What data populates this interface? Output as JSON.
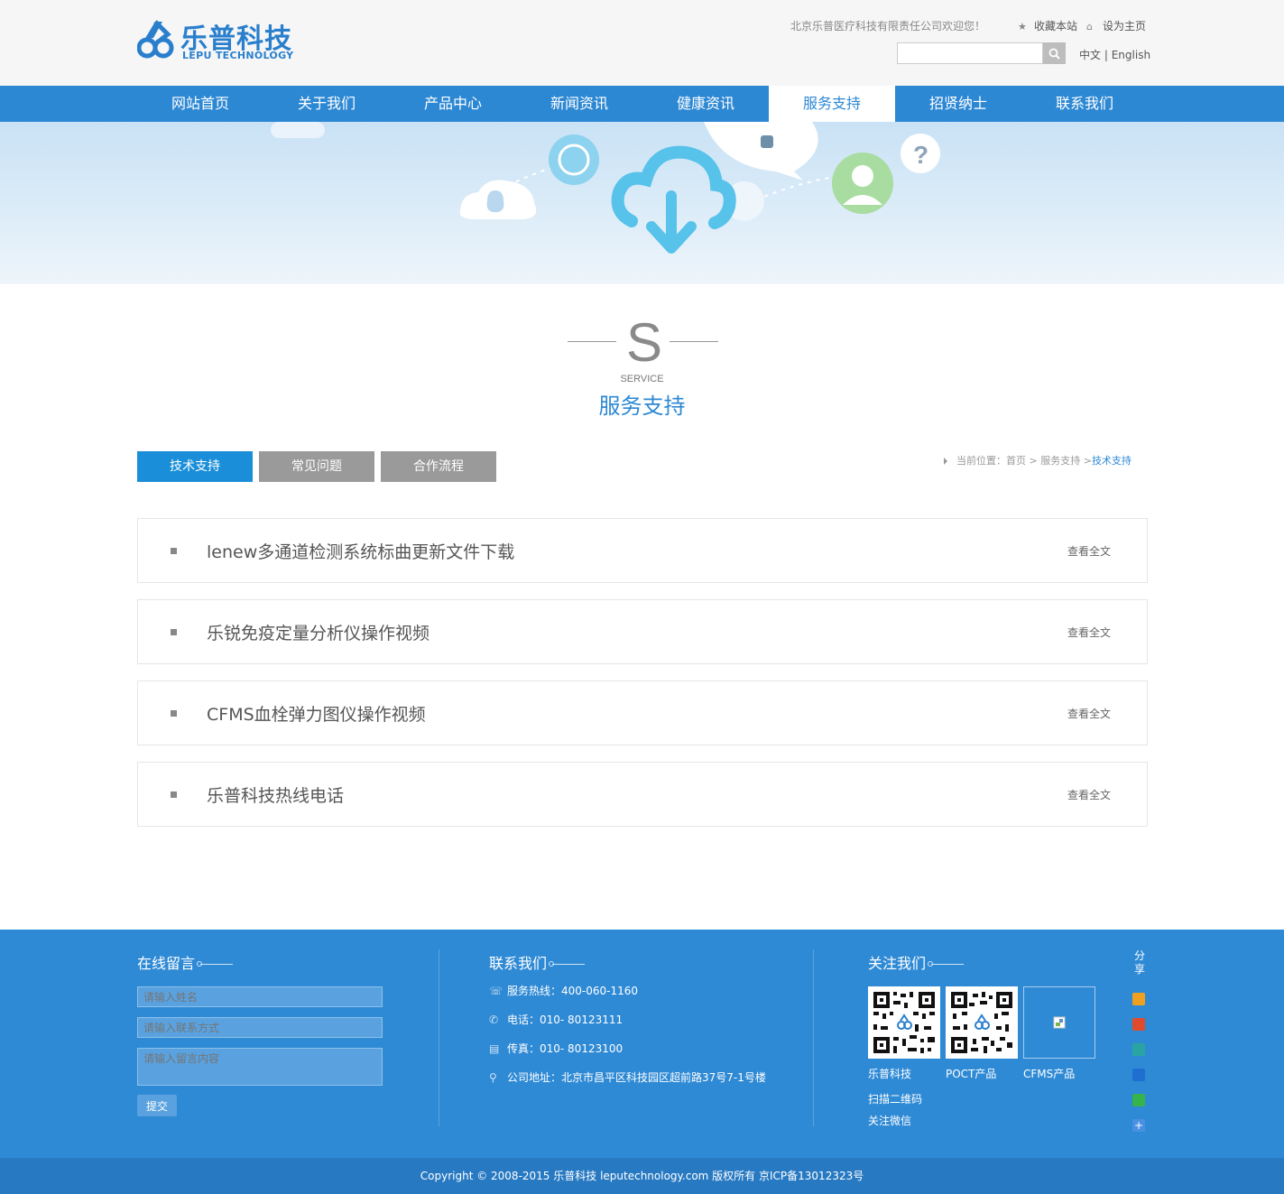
{
  "header": {
    "logo_cn": "乐普科技",
    "logo_en": "LEPU TECHNOLOGY",
    "welcome": "北京乐普医疗科技有限责任公司欢迎您！",
    "favorite": "收藏本站",
    "homepage": "设为主页",
    "search_placeholder": "",
    "lang_cn": "中文",
    "lang_sep": "|",
    "lang_en": "English"
  },
  "nav": {
    "items": [
      "网站首页",
      "关于我们",
      "产品中心",
      "新闻资讯",
      "健康资讯",
      "服务支持",
      "招贤纳士",
      "联系我们"
    ],
    "active_index": 5
  },
  "section": {
    "letter": "S",
    "en": "SERVICE",
    "cn": "服务支持"
  },
  "tabs": [
    "技术支持",
    "常见问题",
    "合作流程"
  ],
  "breadcrumb": {
    "prefix": "当前位置：",
    "home": "首页",
    "sep1": ">",
    "parent": "服务支持",
    "sep2": ">",
    "current": "技术支持"
  },
  "list": [
    {
      "title": "lenew多通道检测系统标曲更新文件下载",
      "more": "查看全文"
    },
    {
      "title": "乐锐免疫定量分析仪操作视频",
      "more": "查看全文"
    },
    {
      "title": "CFMS血栓弹力图仪操作视频",
      "more": "查看全文"
    },
    {
      "title": "乐普科技热线电话",
      "more": "查看全文"
    }
  ],
  "footer": {
    "message": {
      "title": "在线留言",
      "name_placeholder": "请输入姓名",
      "contact_placeholder": "请输入联系方式",
      "content_placeholder": "请输入留言内容",
      "submit": "提交"
    },
    "contact": {
      "title": "联系我们",
      "hotline": "服务热线：400-060-1160",
      "phone": "电话：010- 80123111",
      "fax": "传真：010- 80123100",
      "address": "公司地址：北京市昌平区科技园区超前路37号7-1号楼"
    },
    "follow": {
      "title": "关注我们",
      "qr_labels": [
        "乐普科技",
        "POCT产品",
        "CFMS产品"
      ],
      "note1": "扫描二维码",
      "note2": "关注微信"
    },
    "share": {
      "label": "分享",
      "colors": [
        "#f0a020",
        "#e04b2e",
        "#2aa4a2",
        "#1f6fd1",
        "#36b34a",
        "#4a90e2"
      ]
    },
    "copyright": "Copyright © 2008-2015 乐普科技 leputechnology.com 版权所有 京ICP备13012323号"
  },
  "colors": {
    "brand": "#2d88d4",
    "tab_active": "#1a8ed8",
    "tab_inactive": "#9a9a9a",
    "footer": "#2f8ad5"
  }
}
